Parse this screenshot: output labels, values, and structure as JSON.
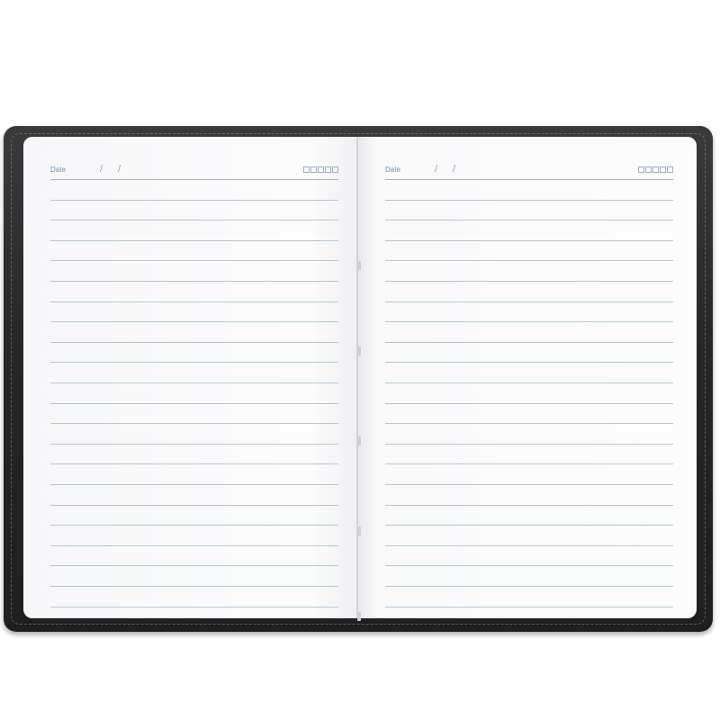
{
  "notebook": {
    "left_page": {
      "date_label": "Date",
      "slash_1": "/",
      "slash_2": "/"
    },
    "right_page": {
      "date_label": "Date",
      "slash_1": "/",
      "slash_2": "/"
    },
    "ruled_lines_per_page": 22,
    "colors": {
      "cover": "#262626",
      "page": "#fbfbfc",
      "rule": "#b9c8d4",
      "date_text": "#6f8fa8"
    }
  }
}
